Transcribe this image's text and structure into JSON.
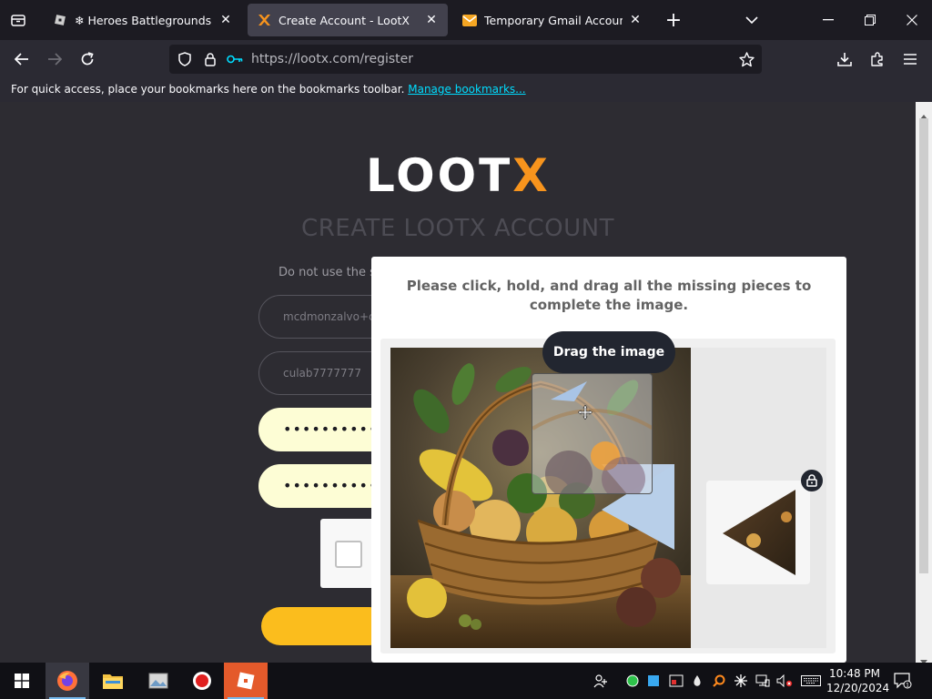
{
  "browser": {
    "tabs": [
      {
        "title": "❄ Heroes Battlegrounds - Robl",
        "active": false,
        "icon": "roblox-icon"
      },
      {
        "title": "Create Account - LootX",
        "active": true,
        "icon": "lootx-icon"
      },
      {
        "title": "Temporary Gmail Account | Gm",
        "active": false,
        "icon": "mail-icon"
      }
    ],
    "url": "https://lootx.com/register",
    "bookmarks_message": "For quick access, place your bookmarks here on the bookmarks toolbar.",
    "bookmarks_link": "Manage bookmarks..."
  },
  "page": {
    "logo_main": "LOOT",
    "logo_accent": "X",
    "heading": "CREATE LOOTX ACCOUNT",
    "warning": "Do not use the sa",
    "fields": {
      "email": "mcdmonzalvo+cc",
      "username": "culab7777777",
      "password": "••••••••••••",
      "confirm_password": "••••••••••••"
    }
  },
  "captcha": {
    "instruction": "Please click, hold, and drag all the missing pieces to complete the image.",
    "tooltip": "Drag the image"
  },
  "taskbar": {
    "time": "10:48 PM",
    "date": "12/20/2024"
  },
  "colors": {
    "brand_accent": "#f7941d",
    "submit": "#fbbd1d",
    "link": "#00ddff"
  }
}
